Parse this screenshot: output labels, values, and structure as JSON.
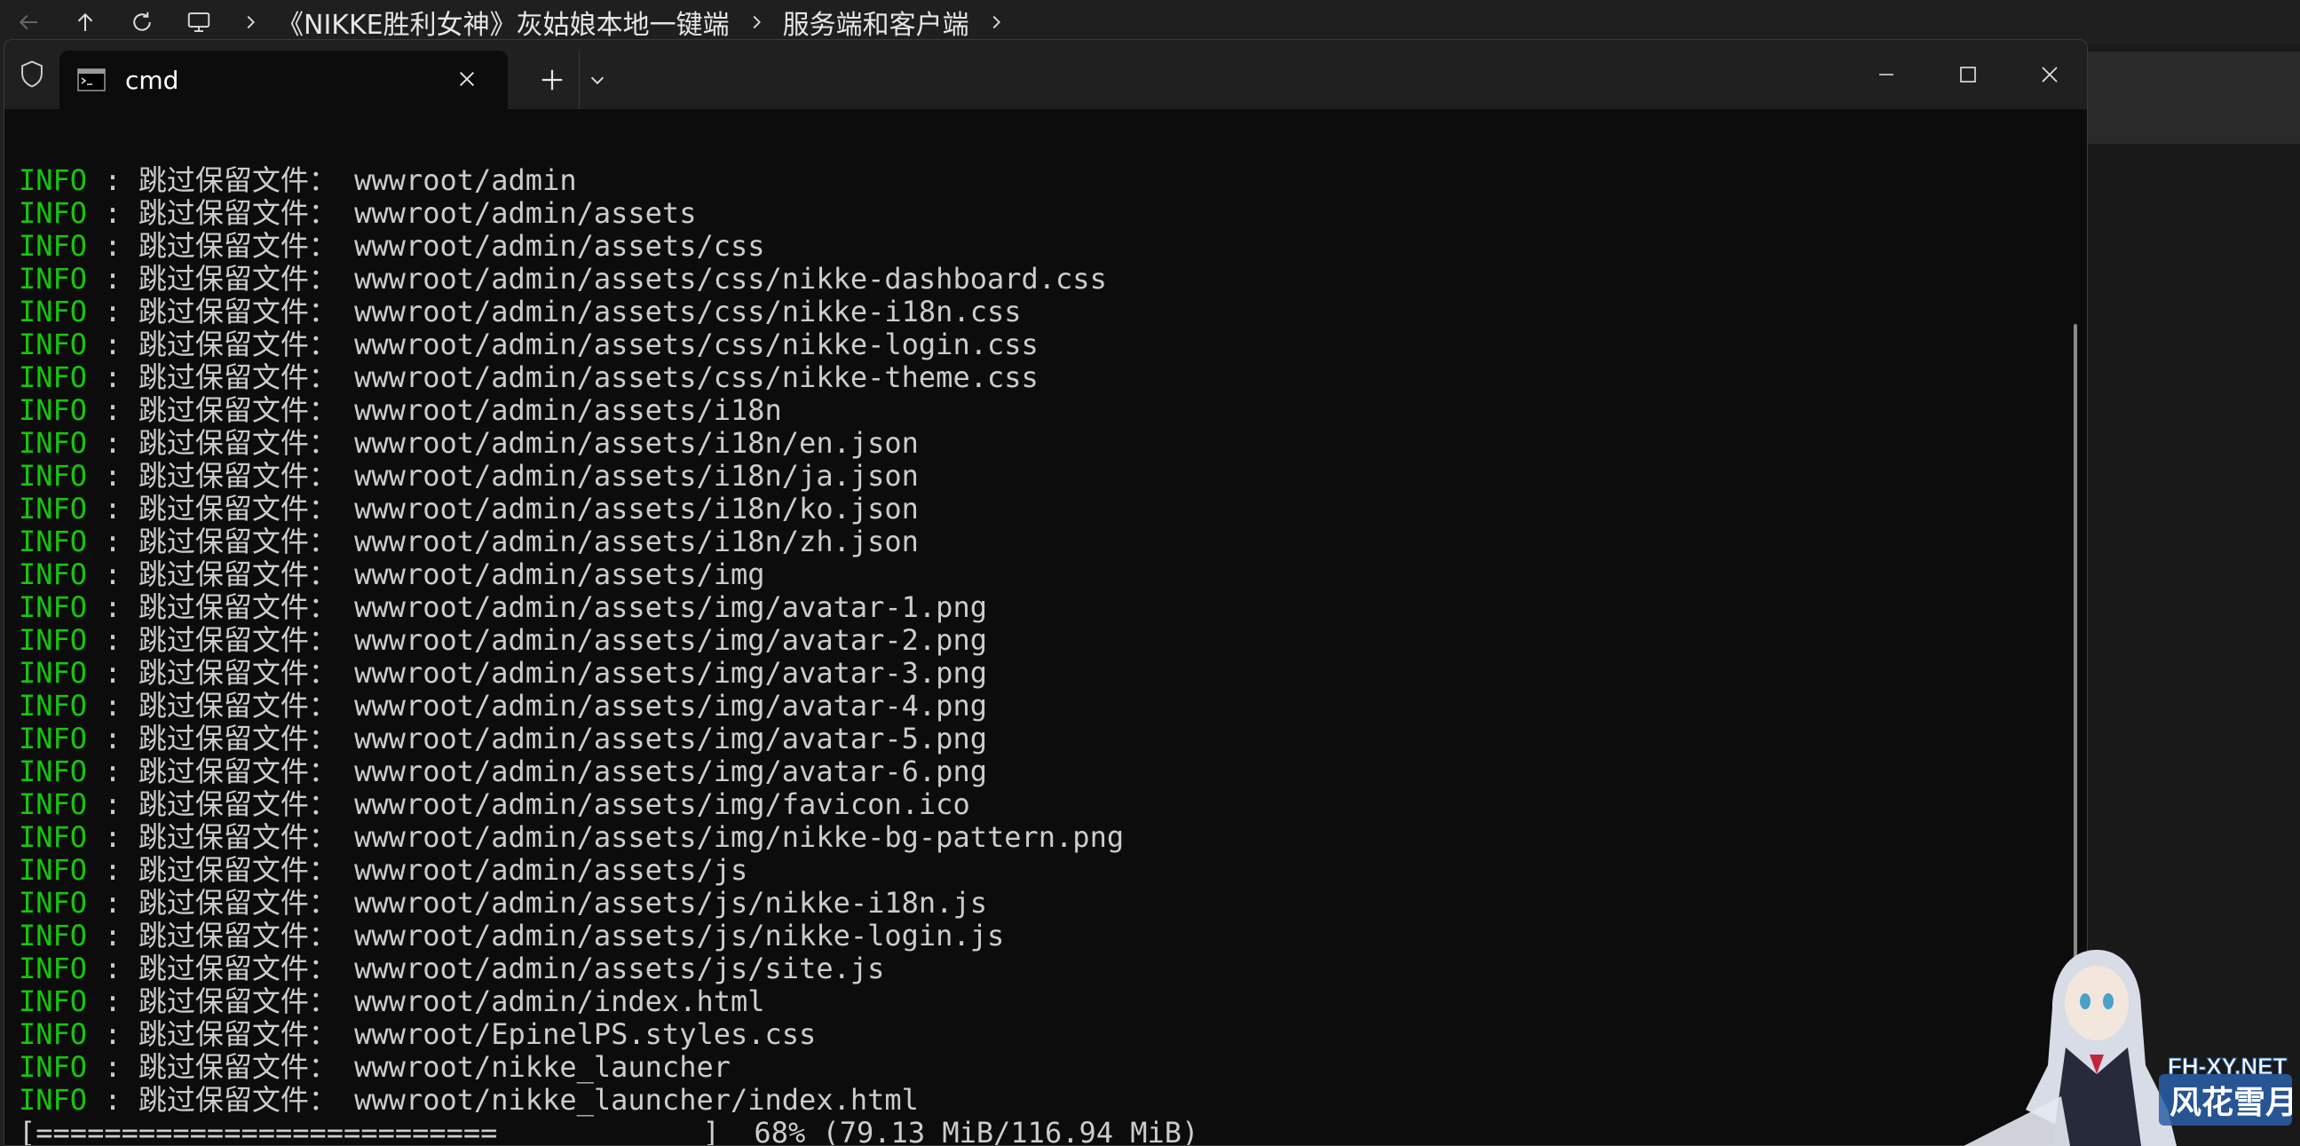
{
  "explorer": {
    "breadcrumbs": [
      "《NIKKE胜利女神》灰姑娘本地一键端",
      "服务端和客户端"
    ]
  },
  "window": {
    "tab_title": "cmd"
  },
  "log": {
    "level": "INFO",
    "separator": " : ",
    "prefix": "跳过保留文件：",
    "paths": [
      "wwwroot/admin",
      "wwwroot/admin/assets",
      "wwwroot/admin/assets/css",
      "wwwroot/admin/assets/css/nikke-dashboard.css",
      "wwwroot/admin/assets/css/nikke-i18n.css",
      "wwwroot/admin/assets/css/nikke-login.css",
      "wwwroot/admin/assets/css/nikke-theme.css",
      "wwwroot/admin/assets/i18n",
      "wwwroot/admin/assets/i18n/en.json",
      "wwwroot/admin/assets/i18n/ja.json",
      "wwwroot/admin/assets/i18n/ko.json",
      "wwwroot/admin/assets/i18n/zh.json",
      "wwwroot/admin/assets/img",
      "wwwroot/admin/assets/img/avatar-1.png",
      "wwwroot/admin/assets/img/avatar-2.png",
      "wwwroot/admin/assets/img/avatar-3.png",
      "wwwroot/admin/assets/img/avatar-4.png",
      "wwwroot/admin/assets/img/avatar-5.png",
      "wwwroot/admin/assets/img/avatar-6.png",
      "wwwroot/admin/assets/img/favicon.ico",
      "wwwroot/admin/assets/img/nikke-bg-pattern.png",
      "wwwroot/admin/assets/js",
      "wwwroot/admin/assets/js/nikke-i18n.js",
      "wwwroot/admin/assets/js/nikke-login.js",
      "wwwroot/admin/assets/js/site.js",
      "wwwroot/admin/index.html",
      "wwwroot/EpinelPS.styles.css",
      "wwwroot/nikke_launcher",
      "wwwroot/nikke_launcher/index.html"
    ],
    "progress_line": "[===========================            ]  68% (79.13 MiB/116.94 MiB)",
    "progress_percent": 68
  },
  "watermark": {
    "site": "FH-XY.NET",
    "name": "风花雪月"
  },
  "colors": {
    "info": "#16c60c",
    "text": "#cccccc",
    "terminal_bg": "#0c0c0c"
  },
  "icons": [
    "back-arrow-icon",
    "up-arrow-icon",
    "refresh-icon",
    "this-pc-icon",
    "chevron-right-icon",
    "shield-icon",
    "cmd-icon",
    "close-icon",
    "plus-icon",
    "chevron-down-icon",
    "minimize-icon",
    "maximize-icon"
  ]
}
